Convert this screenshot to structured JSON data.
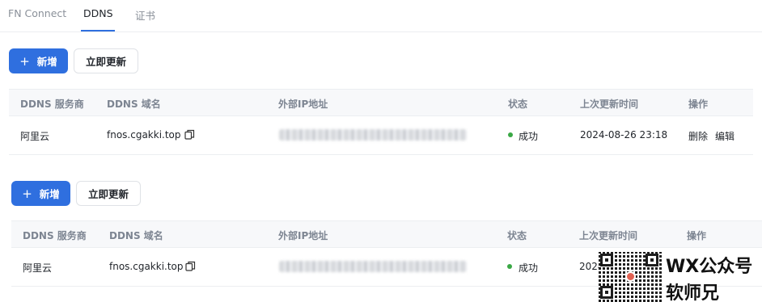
{
  "tabs": [
    {
      "label": "FN Connect",
      "active": false
    },
    {
      "label": "DDNS",
      "active": true
    },
    {
      "label": "证书",
      "active": false
    }
  ],
  "sections": [
    {
      "add_label": "新增",
      "update_label": "立即更新",
      "columns": [
        "DDNS 服务商",
        "DDNS 域名",
        "外部IP地址",
        "状态",
        "上次更新时间",
        "操作"
      ],
      "row": {
        "provider": "阿里云",
        "domain": "fnos.cgakki.top",
        "status": "成功",
        "last_update": "2024-08-26 23:18",
        "delete_label": "删除",
        "edit_label": "编辑"
      }
    },
    {
      "add_label": "新增",
      "update_label": "立即更新",
      "columns": [
        "DDNS 服务商",
        "DDNS 域名",
        "外部IP地址",
        "状态",
        "上次更新时间",
        "操作"
      ],
      "row": {
        "provider": "阿里云",
        "domain": "fnos.cgakki.top",
        "status": "成功",
        "last_update": "2024"
      }
    }
  ],
  "watermark": {
    "line1": "WX公众号",
    "line2": "软师兄"
  },
  "colors": {
    "accent": "#2f6fdf",
    "success": "#3aa845"
  }
}
